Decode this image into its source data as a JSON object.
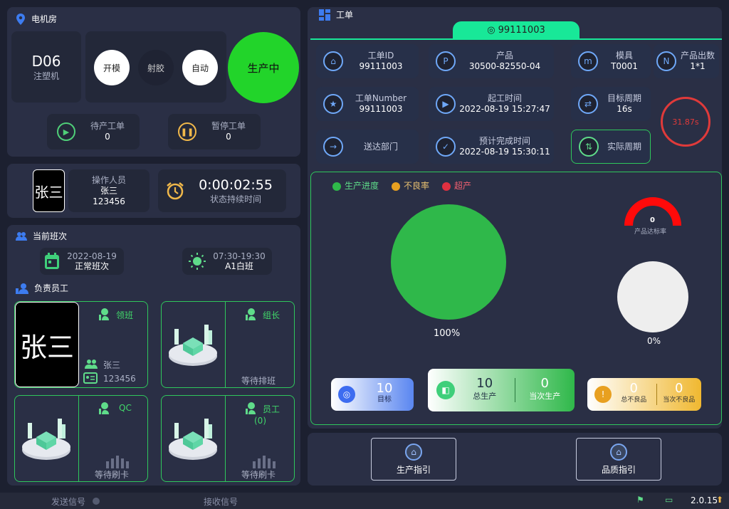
{
  "machine_room": {
    "title": "电机房",
    "machine_code": "D06",
    "machine_type": "注塑机",
    "btn_open": "开模",
    "btn_inject": "射胶",
    "btn_auto": "自动",
    "status": "生产中",
    "pending_label": "待产工单",
    "pending_value": "0",
    "paused_label": "暂停工单",
    "paused_value": "0"
  },
  "operator": {
    "avatar_text": "张三",
    "label": "操作人员",
    "name": "张三",
    "id": "123456",
    "timer": "0:00:02:55",
    "timer_label": "状态持续时间"
  },
  "shift": {
    "title": "当前班次",
    "date": "2022-08-19",
    "shift_type": "正常班次",
    "time_range": "07:30-19:30",
    "shift_name": "A1白班"
  },
  "staff": {
    "title": "负责员工",
    "leader": {
      "avatar_text": "张三",
      "role": "领班",
      "name": "张三",
      "id": "123456"
    },
    "group_leader": {
      "role": "组长",
      "status": "等待排班"
    },
    "qc": {
      "role": "QC",
      "status": "等待刷卡"
    },
    "worker": {
      "role": "员工",
      "count": "(0)",
      "status": "等待刷卡"
    }
  },
  "work_order": {
    "title": "工单",
    "tab_id": "99111003",
    "fields": {
      "order_id_label": "工单ID",
      "order_id_value": "99111003",
      "product_label": "产品",
      "product_value": "30500-82550-04",
      "mold_label": "模具",
      "mold_value": "T0001",
      "output_label": "产品出数",
      "output_value": "1*1",
      "order_number_label": "工单Number",
      "order_number_value": "99111003",
      "start_label": "起工时间",
      "start_value": "2022-08-19 15:27:47",
      "target_cycle_label": "目标周期",
      "target_cycle_value": "16s",
      "dept_label": "送达部门",
      "dept_value": "",
      "finish_label": "预计完成时间",
      "finish_value": "2022-08-19 15:30:11",
      "actual_cycle_label": "实际周期"
    },
    "cycle_gauge": "31.87s"
  },
  "progress": {
    "legend": [
      {
        "label": "生产进度",
        "color": "#2fb84a"
      },
      {
        "label": "不良率",
        "color": "#e8a020"
      },
      {
        "label": "超产",
        "color": "#e03040"
      }
    ],
    "main_percent": "100%",
    "gauge_value": "0",
    "gauge_label": "产品达标率",
    "defect_percent": "0%",
    "target_value": "10",
    "target_label": "目标",
    "total_value": "10",
    "total_label": "总生产",
    "current_value": "0",
    "current_label": "当次生产",
    "total_defect_value": "0",
    "total_defect_label": "总不良品",
    "current_defect_value": "0",
    "current_defect_label": "当次不良品"
  },
  "guides": {
    "production": "生产指引",
    "quality": "品质指引"
  },
  "statusbar": {
    "send": "发送信号",
    "receive": "接收信号",
    "version": "2.0.15"
  }
}
